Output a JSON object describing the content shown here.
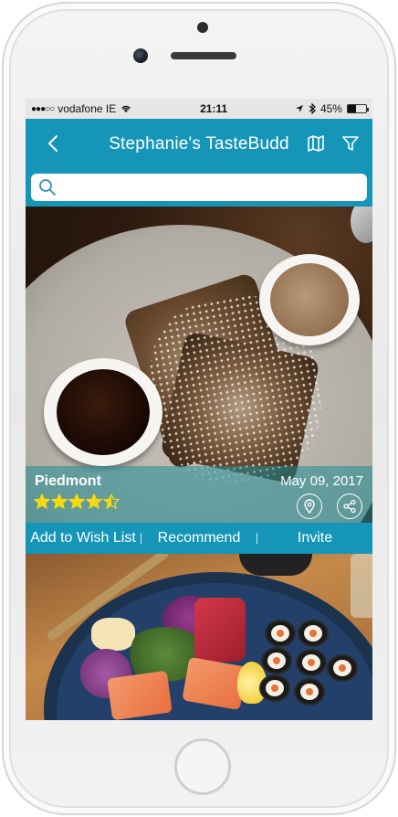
{
  "status_bar": {
    "signal": "●●●○○",
    "carrier": "vodafone IE",
    "time": "21:11",
    "battery_text": "45%",
    "battery_level": 0.45
  },
  "nav": {
    "title": "Stephanie's TasteBudd",
    "back_icon": "chevron-left-icon",
    "map_icon": "map-icon",
    "filter_icon": "filter-icon"
  },
  "search": {
    "placeholder": "",
    "value": ""
  },
  "posts": [
    {
      "place": "Piedmont",
      "date": "May 09, 2017",
      "rating": 4.5,
      "rating_max": 5,
      "actions": {
        "wish": "Add to Wish List",
        "recommend": "Recommend",
        "invite": "Invite"
      }
    }
  ],
  "colors": {
    "accent": "#1595b8",
    "star": "#f5d90f"
  }
}
